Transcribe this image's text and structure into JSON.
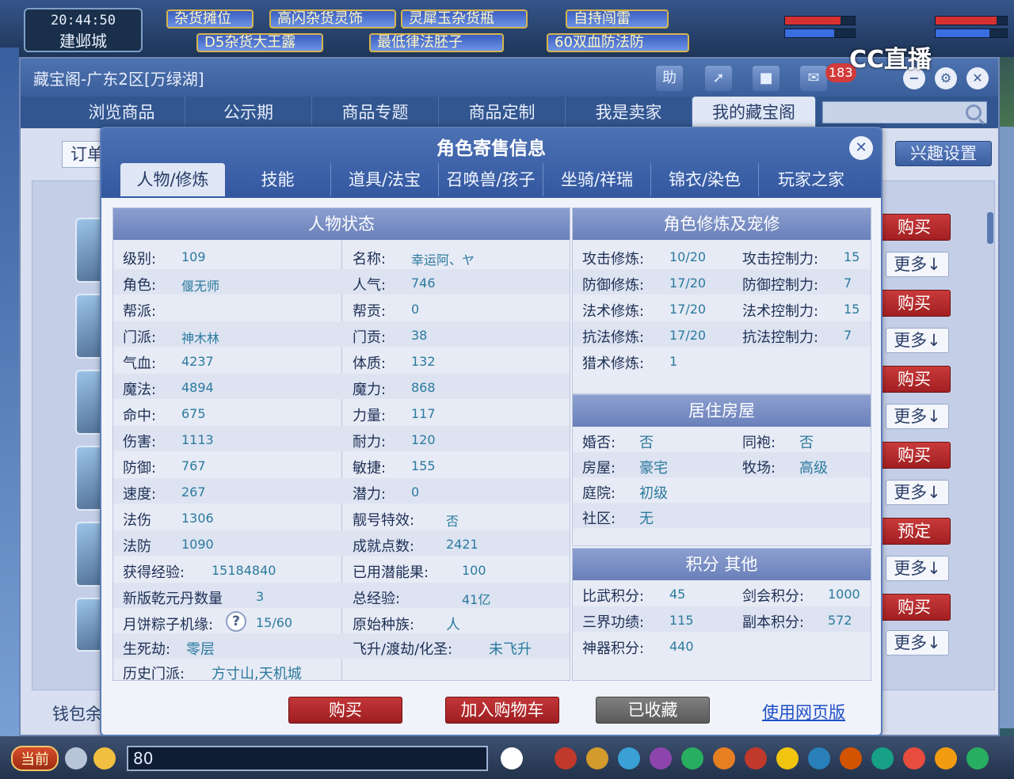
{
  "game": {
    "time": "20:44:50",
    "city": "建邺城",
    "stalls": [
      "杂货摊位",
      "高闪杂货灵饰",
      "灵犀玉杂货瓶",
      "自持闯雷",
      "D5杂货大王露",
      "最低律法胚子",
      "60双血防法防"
    ],
    "watermark": "CC直播",
    "chat_channel": "当前",
    "chat_value": "80",
    "colors": {
      "red_button": "#b02a2d",
      "blue_header": "#3a5e99",
      "accent_text": "#2b7a9e"
    }
  },
  "window": {
    "title": "藏宝阁-广东2区[万绿湖]",
    "header_buttons": [
      "助",
      "share-icon",
      "stop-icon",
      "chat-icon",
      "cart-icon"
    ],
    "notification_count": "183",
    "nav_tabs": [
      "浏览商品",
      "公示期",
      "商品专题",
      "商品定制",
      "我是卖家",
      "我的藏宝阁"
    ],
    "active_nav": "我的藏宝阁",
    "order_tab": "订单",
    "interest_button": "兴趣设置",
    "wallet_label": "钱包余",
    "side_actions": [
      {
        "primary": "购买",
        "more": "更多↓"
      },
      {
        "primary": "购买",
        "more": "更多↓"
      },
      {
        "primary": "购买",
        "more": "更多↓"
      },
      {
        "primary": "购买",
        "more": "更多↓"
      },
      {
        "primary": "预定",
        "more": "更多↓"
      },
      {
        "primary": "购买",
        "more": "更多↓"
      }
    ]
  },
  "modal": {
    "title": "角色寄售信息",
    "tabs": [
      "人物/修炼",
      "技能",
      "道具/法宝",
      "召唤兽/孩子",
      "坐骑/祥瑞",
      "锦衣/染色",
      "玩家之家"
    ],
    "active_tab": "人物/修炼",
    "status": {
      "title": "人物状态",
      "left": [
        {
          "label": "级别:",
          "value": "109"
        },
        {
          "label": "角色:",
          "value": "偃无师"
        },
        {
          "label": "帮派:",
          "value": ""
        },
        {
          "label": "门派:",
          "value": "神木林"
        },
        {
          "label": "气血:",
          "value": "4237"
        },
        {
          "label": "魔法:",
          "value": "4894"
        },
        {
          "label": "命中:",
          "value": "675"
        },
        {
          "label": "伤害:",
          "value": "1113"
        },
        {
          "label": "防御:",
          "value": "767"
        },
        {
          "label": "速度:",
          "value": "267"
        },
        {
          "label": "法伤",
          "value": "1306"
        },
        {
          "label": "法防",
          "value": "1090"
        },
        {
          "label": "获得经验:",
          "value": "15184840"
        },
        {
          "label": "新版乾元丹数量",
          "value": "3"
        },
        {
          "label": "月饼粽子机缘:",
          "value": "15/60"
        },
        {
          "label": "生死劫:",
          "value": "零层"
        },
        {
          "label": "历史门派:",
          "value": "方寸山,天机城"
        }
      ],
      "right": [
        {
          "label": "名称:",
          "value": "幸运阿、ヤ"
        },
        {
          "label": "人气:",
          "value": "746"
        },
        {
          "label": "帮贡:",
          "value": "0"
        },
        {
          "label": "门贡:",
          "value": "38"
        },
        {
          "label": "体质:",
          "value": "132"
        },
        {
          "label": "魔力:",
          "value": "868"
        },
        {
          "label": "力量:",
          "value": "117"
        },
        {
          "label": "耐力:",
          "value": "120"
        },
        {
          "label": "敏捷:",
          "value": "155"
        },
        {
          "label": "潜力:",
          "value": "0"
        },
        {
          "label": "靓号特效:",
          "value": "否"
        },
        {
          "label": "成就点数:",
          "value": "2421"
        },
        {
          "label": "已用潜能果:",
          "value": "100"
        },
        {
          "label": "总经验:",
          "value": "41亿"
        },
        {
          "label": "原始种族:",
          "value": "人"
        },
        {
          "label": "飞升/渡劫/化圣:",
          "value": "未飞升"
        }
      ],
      "help_icon": "?"
    },
    "cultivation": {
      "title": "角色修炼及宠修",
      "left": [
        {
          "label": "攻击修炼:",
          "value": "10/20"
        },
        {
          "label": "防御修炼:",
          "value": "17/20"
        },
        {
          "label": "法术修炼:",
          "value": "17/20"
        },
        {
          "label": "抗法修炼:",
          "value": "17/20"
        },
        {
          "label": "猎术修炼:",
          "value": "1"
        }
      ],
      "right": [
        {
          "label": "攻击控制力:",
          "value": "15"
        },
        {
          "label": "防御控制力:",
          "value": "7"
        },
        {
          "label": "法术控制力:",
          "value": "15"
        },
        {
          "label": "抗法控制力:",
          "value": "7"
        }
      ]
    },
    "house": {
      "title": "居住房屋",
      "left": [
        {
          "label": "婚否:",
          "value": "否"
        },
        {
          "label": "房屋:",
          "value": "豪宅"
        },
        {
          "label": "庭院:",
          "value": "初级"
        },
        {
          "label": "社区:",
          "value": "无"
        }
      ],
      "right": [
        {
          "label": "同袍:",
          "value": "否"
        },
        {
          "label": "牧场:",
          "value": "高级"
        }
      ]
    },
    "points": {
      "title": "积分 其他",
      "left": [
        {
          "label": "比武积分:",
          "value": "45"
        },
        {
          "label": "三界功绩:",
          "value": "115"
        },
        {
          "label": "神器积分:",
          "value": "440"
        }
      ],
      "right": [
        {
          "label": "剑会积分:",
          "value": "1000"
        },
        {
          "label": "副本积分:",
          "value": "572"
        }
      ]
    },
    "buttons": {
      "buy": "购买",
      "cart": "加入购物车",
      "collected": "已收藏",
      "web": "使用网页版"
    }
  }
}
